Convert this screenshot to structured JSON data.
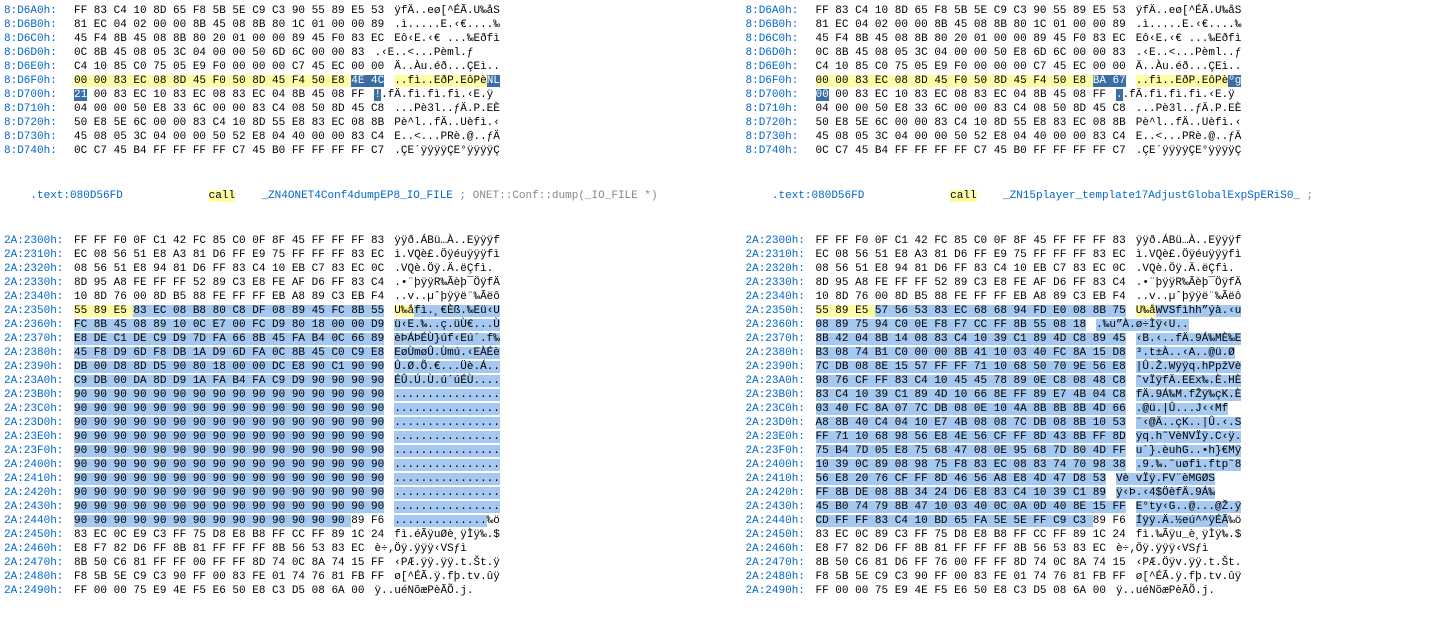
{
  "left": {
    "upper": [
      {
        "addr": "8:D6A0h:",
        "bytes": "FF 83 C4 10 8D 65 F8 5B 5E C9 C3 90 55 89 E5 53",
        "ascii": "ÿfÄ..eø[^ÉÃ.U‰åS"
      },
      {
        "addr": "8:D6B0h:",
        "bytes": "81 EC 04 02 00 00 8B 45 08 8B 80 1C 01 00 00 89",
        "ascii": ".ì.....E.‹€....‰"
      },
      {
        "addr": "8:D6C0h:",
        "bytes": "45 F4 8B 45 08 8B 80 20 01 00 00 89 45 F0 83 EC",
        "ascii": "Eô‹E.‹€ ...‰Eðfì"
      },
      {
        "addr": "8:D6D0h:",
        "bytes": "0C 8B 45 08 05 3C 04 00 00 50 6D 6C 00 00 83",
        "ascii": ".‹E..<...Pèml.ƒ"
      },
      {
        "addr": "8:D6E0h:",
        "bytes": "C4 10 85 C0 75 05 E9 F0 00 00 00 C7 45 EC 00 00",
        "ascii": "Ä..Àu.éð...ÇEì.."
      },
      {
        "addr": "8:D6F0h:",
        "bytes": "",
        "ascii": "..fì..EðP.EôPè",
        "hlbytes": [
          {
            "t": "00 00 83 EC 08 8D 45 F0 50 8D 45 F4 50 E8 ",
            "cls": "hl-yellow"
          },
          {
            "t": "4E 4C",
            "cls": "hl-blue-dark"
          }
        ],
        "asciiparts": [
          {
            "t": "..fì..EðP.EôPè",
            "cls": "hl-yellow"
          },
          {
            "t": "NL",
            "cls": "hl-blue-dark"
          }
        ]
      },
      {
        "addr": "8:D700h:",
        "bytes": "",
        "ascii": "",
        "hlbytes": [
          {
            "t": "21",
            "cls": "hl-blue-dark"
          },
          {
            "t": " 00 83 EC 10 83 EC 08 83 EC 04 8B 45 08 FF",
            "cls": ""
          }
        ],
        "asciiparts": [
          {
            "t": "!",
            "cls": "hl-blue-dark"
          },
          {
            "t": ".fÄ.fì.fì.fì.‹E.ÿ",
            "cls": ""
          }
        ]
      },
      {
        "addr": "8:D710h:",
        "bytes": "04 00 00 50 E8 33 6C 00 00 83 C4 08 50 8D 45 C8",
        "ascii": "...Pè3l..ƒÄ.P.EÈ"
      },
      {
        "addr": "8:D720h:",
        "bytes": "50 E8 5E 6C 00 00 83 C4 10 8D 55 E8 83 EC 08 8B",
        "ascii": "Pè^l..fÄ..Uèfì.‹"
      },
      {
        "addr": "8:D730h:",
        "bytes": "45 08 05 3C 04 00 00 50 52 E8 04 40 00 00 83 C4",
        "ascii": "E..<...PRè.@..ƒÄ"
      },
      {
        "addr": "8:D740h:",
        "bytes": "0C C7 45 B4 FF FF FF FF C7 45 B0 FF FF FF FF C7",
        "ascii": ".ÇE´ÿÿÿÿÇE°ÿÿÿÿÇ"
      }
    ],
    "disasm": {
      "addr": ".text:080D56FD",
      "mnem": "call",
      "op": "_ZN4ONET4Conf4dumpEP8_IO_FILE",
      "comment": "; ONET::Conf::dump(_IO_FILE *)"
    },
    "lower": [
      {
        "addr": "2A:2300h:",
        "bytes": "FF FF F0 0F C1 42 FC 85 C0 0F 8F 45 FF FF FF 83",
        "ascii": "ÿÿð.ÁBü…À..Eÿÿÿf"
      },
      {
        "addr": "2A:2310h:",
        "bytes": "EC 08 56 51 E8 A3 81 D6 FF E9 75 FF FF FF 83 EC",
        "ascii": "ì.VQè£.Öÿéuÿÿÿfì"
      },
      {
        "addr": "2A:2320h:",
        "bytes": "08 56 51 E8 94 81 D6 FF 83 C4 10 EB C7 83 EC 0C",
        "ascii": ".VQè.Öÿ.Ä.ëÇfì."
      },
      {
        "addr": "2A:2330h:",
        "bytes": "8D 95 A8 FE FF FF 52 89 C3 E8 FE AF D6 FF 83 C4",
        "ascii": ".•¨þÿÿR‰Ãèþ¯ÖÿfÄ"
      },
      {
        "addr": "2A:2340h:",
        "bytes": "10 8D 76 00 8D B5 88 FE FF FF EB A8 89 C3 EB F4",
        "ascii": "..v..µˆþÿÿë¨‰Ãëô"
      },
      {
        "addr": "2A:2350h:",
        "bytes": "",
        "hlbytes": [
          {
            "t": "55 89 E5 ",
            "cls": "hl-yellow"
          },
          {
            "t": "83 EC 08 B8 80 C8 DF 08 89 45 FC 8B 55",
            "cls": "hl-blue"
          }
        ],
        "asciiparts": [
          {
            "t": "U‰å",
            "cls": "hl-yellow"
          },
          {
            "t": "fì.¸€Èß.‰Eü‹U",
            "cls": "hl-blue"
          }
        ]
      },
      {
        "addr": "2A:2360h:",
        "bytes": "",
        "hlbytes": [
          {
            "t": "FC 8B 45 08 89 10 0C E7 00 FC D9 80 18 00 00 D9",
            "cls": "hl-blue"
          }
        ],
        "asciiparts": [
          {
            "t": "ü‹E.‰..ç.üÙ€...Ù",
            "cls": "hl-blue"
          }
        ]
      },
      {
        "addr": "2A:2370h:",
        "bytes": "",
        "hlbytes": [
          {
            "t": "E8 DE C1 DE C9 D9 7D FA 66 8B 45 FA B4 0C 66 89",
            "cls": "hl-blue"
          }
        ],
        "asciiparts": [
          {
            "t": "èÞÁÞÉÙ}úf‹Eú´.f‰",
            "cls": "hl-blue"
          }
        ]
      },
      {
        "addr": "2A:2380h:",
        "bytes": "",
        "hlbytes": [
          {
            "t": "45 F8 D9 6D F8 DB 1A D9 6D FA 0C 8B 45 C0 C9 E8",
            "cls": "hl-blue"
          }
        ],
        "asciiparts": [
          {
            "t": "EøÙmøÛ.Ùmú.‹EÀÉè",
            "cls": "hl-blue"
          }
        ]
      },
      {
        "addr": "2A:2390h:",
        "bytes": "",
        "hlbytes": [
          {
            "t": "DB 00 D8 8D D5 90 80 18 00 00 DC E8 90 C1 90 90",
            "cls": "hl-blue"
          }
        ],
        "asciiparts": [
          {
            "t": "Û.Ø.Õ.€...Üè.Á..",
            "cls": "hl-blue"
          }
        ]
      },
      {
        "addr": "2A:23A0h:",
        "bytes": "",
        "hlbytes": [
          {
            "t": "C9 DB 00 DA 8D D9 1A FA B4 FA C9 D9 90 90 90 90",
            "cls": "hl-blue"
          }
        ],
        "asciiparts": [
          {
            "t": "ÉÛ.Ú.Ù.ú´úÉÙ....",
            "cls": "hl-blue"
          }
        ]
      },
      {
        "addr": "2A:23B0h:",
        "bytes": "",
        "hlbytes": [
          {
            "t": "90 90 90 90 90 90 90 90 90 90 90 90 90 90 90 90",
            "cls": "hl-blue"
          }
        ],
        "asciiparts": [
          {
            "t": "................",
            "cls": "hl-blue"
          }
        ]
      },
      {
        "addr": "2A:23C0h:",
        "bytes": "",
        "hlbytes": [
          {
            "t": "90 90 90 90 90 90 90 90 90 90 90 90 90 90 90 90",
            "cls": "hl-blue"
          }
        ],
        "asciiparts": [
          {
            "t": "................",
            "cls": "hl-blue"
          }
        ]
      },
      {
        "addr": "2A:23D0h:",
        "bytes": "",
        "hlbytes": [
          {
            "t": "90 90 90 90 90 90 90 90 90 90 90 90 90 90 90 90",
            "cls": "hl-blue"
          }
        ],
        "asciiparts": [
          {
            "t": "................",
            "cls": "hl-blue"
          }
        ]
      },
      {
        "addr": "2A:23E0h:",
        "bytes": "",
        "hlbytes": [
          {
            "t": "90 90 90 90 90 90 90 90 90 90 90 90 90 90 90 90",
            "cls": "hl-blue"
          }
        ],
        "asciiparts": [
          {
            "t": "................",
            "cls": "hl-blue"
          }
        ]
      },
      {
        "addr": "2A:23F0h:",
        "bytes": "",
        "hlbytes": [
          {
            "t": "90 90 90 90 90 90 90 90 90 90 90 90 90 90 90 90",
            "cls": "hl-blue"
          }
        ],
        "asciiparts": [
          {
            "t": "................",
            "cls": "hl-blue"
          }
        ]
      },
      {
        "addr": "2A:2400h:",
        "bytes": "",
        "hlbytes": [
          {
            "t": "90 90 90 90 90 90 90 90 90 90 90 90 90 90 90 90",
            "cls": "hl-blue"
          }
        ],
        "asciiparts": [
          {
            "t": "................",
            "cls": "hl-blue"
          }
        ]
      },
      {
        "addr": "2A:2410h:",
        "bytes": "",
        "hlbytes": [
          {
            "t": "90 90 90 90 90 90 90 90 90 90 90 90 90 90 90 90",
            "cls": "hl-blue"
          }
        ],
        "asciiparts": [
          {
            "t": "................",
            "cls": "hl-blue"
          }
        ]
      },
      {
        "addr": "2A:2420h:",
        "bytes": "",
        "hlbytes": [
          {
            "t": "90 90 90 90 90 90 90 90 90 90 90 90 90 90 90 90",
            "cls": "hl-blue"
          }
        ],
        "asciiparts": [
          {
            "t": "................",
            "cls": "hl-blue"
          }
        ]
      },
      {
        "addr": "2A:2430h:",
        "bytes": "",
        "hlbytes": [
          {
            "t": "90 90 90 90 90 90 90 90 90 90 90 90 90 90 90 90",
            "cls": "hl-blue"
          }
        ],
        "asciiparts": [
          {
            "t": "................",
            "cls": "hl-blue"
          }
        ]
      },
      {
        "addr": "2A:2440h:",
        "bytes": "",
        "hlbytes": [
          {
            "t": "90 90 90 90 90 90 90 90 90 90 90 90 90 90 ",
            "cls": "hl-blue"
          },
          {
            "t": "89 F6",
            "cls": ""
          }
        ],
        "asciiparts": [
          {
            "t": "..............",
            "cls": "hl-blue"
          },
          {
            "t": "‰ö",
            "cls": ""
          }
        ]
      },
      {
        "addr": "2A:2450h:",
        "bytes": "83 EC 0C E9 C3 FF 75 D8 E8 B8 FF CC FF 89 1C 24",
        "ascii": "fì.éÃÿuØè¸ÿÌÿ‰.$"
      },
      {
        "addr": "2A:2460h:",
        "bytes": "E8 F7 82 D6 FF 8B 81 FF FF FF 8B 56 53 83 EC",
        "ascii": "è÷‚Öÿ.ÿÿÿ‹VSƒì"
      },
      {
        "addr": "2A:2470h:",
        "bytes": "8B 50 C6 81 FF FF 00 FF FF 8D 74 0C 8A 74 15 FF",
        "ascii": "‹PÆ.ÿÿ.ÿÿ.t.Št.ÿ"
      },
      {
        "addr": "2A:2480h:",
        "bytes": "F8 5B 5E C9 C3 90 FF 00 83 FE 01 74 76 81 FB FF",
        "ascii": "ø[^ÉÃ.ÿ.fþ.tv.ûÿ"
      },
      {
        "addr": "2A:2490h:",
        "bytes": "FF 00 00 75 E9 4E F5 E6 50 E8 C3 D5 08 6A 00",
        "ascii": "ÿ..uéNõæPèÃÕ.j."
      }
    ]
  },
  "right": {
    "upper": [
      {
        "addr": "8:D6A0h:",
        "bytes": "FF 83 C4 10 8D 65 F8 5B 5E C9 C3 90 55 89 E5 53",
        "ascii": "ÿfÄ..eø[^ÉÃ.U‰åS"
      },
      {
        "addr": "8:D6B0h:",
        "bytes": "81 EC 04 02 00 00 8B 45 08 8B 80 1C 01 00 00 89",
        "ascii": ".ì.....E.‹€....‰"
      },
      {
        "addr": "8:D6C0h:",
        "bytes": "45 F4 8B 45 08 8B 80 20 01 00 00 89 45 F0 83 EC",
        "ascii": "Eô‹E.‹€ ...‰Eðfì"
      },
      {
        "addr": "8:D6D0h:",
        "bytes": "0C 8B 45 08 05 3C 04 00 00 50 E8 6D 6C 00 00 83",
        "ascii": ".‹E..<...Pèml..ƒ"
      },
      {
        "addr": "8:D6E0h:",
        "bytes": "C4 10 85 C0 75 05 E9 F0 00 00 00 C7 45 EC 00 00",
        "ascii": "Ä..Àu.éð...ÇEì.."
      },
      {
        "addr": "8:D6F0h:",
        "bytes": "",
        "hlbytes": [
          {
            "t": "00 00 83 EC 08 8D 45 F0 50 8D 45 F4 50 E8 ",
            "cls": "hl-yellow"
          },
          {
            "t": "BA 67",
            "cls": "hl-blue-dark"
          }
        ],
        "asciiparts": [
          {
            "t": "..fì..EðP.EôPè",
            "cls": "hl-yellow"
          },
          {
            "t": "ºg",
            "cls": "hl-blue-dark"
          }
        ]
      },
      {
        "addr": "8:D700h:",
        "bytes": "",
        "hlbytes": [
          {
            "t": "00",
            "cls": "hl-blue-dark"
          },
          {
            "t": " 00 83 EC 10 83 EC 08 83 EC 04 8B 45 08 FF",
            "cls": ""
          }
        ],
        "asciiparts": [
          {
            "t": ".",
            "cls": "hl-blue-dark"
          },
          {
            "t": ".fÄ.fì.fì.fì.‹E.ÿ",
            "cls": ""
          }
        ]
      },
      {
        "addr": "8:D710h:",
        "bytes": "04 00 00 50 E8 33 6C 00 00 83 C4 08 50 8D 45 C8",
        "ascii": "...Pè3l..ƒÄ.P.EÈ"
      },
      {
        "addr": "8:D720h:",
        "bytes": "50 E8 5E 6C 00 00 83 C4 10 8D 55 E8 83 EC 08 8B",
        "ascii": "Pè^l..fÄ..Uèfì.‹"
      },
      {
        "addr": "8:D730h:",
        "bytes": "45 08 05 3C 04 00 00 50 52 E8 04 40 00 00 83 C4",
        "ascii": "E..<...PRè.@..ƒÄ"
      },
      {
        "addr": "8:D740h:",
        "bytes": "0C C7 45 B4 FF FF FF FF C7 45 B0 FF FF FF FF C7",
        "ascii": ".ÇE´ÿÿÿÿÇE°ÿÿÿÿÇ"
      }
    ],
    "disasm": {
      "addr": ".text:080D56FD",
      "mnem": "call",
      "op": "_ZN15player_template17AdjustGlobalExpSpERiS0_",
      "comment": ";"
    },
    "lower": [
      {
        "addr": "2A:2300h:",
        "bytes": "FF FF F0 0F C1 42 FC 85 C0 0F 8F 45 FF FF FF 83",
        "ascii": "ÿÿð.ÁBü…À..Eÿÿÿf"
      },
      {
        "addr": "2A:2310h:",
        "bytes": "EC 08 56 51 E8 A3 81 D6 FF E9 75 FF FF FF 83 EC",
        "ascii": "ì.VQè£.Öÿéuÿÿÿfì"
      },
      {
        "addr": "2A:2320h:",
        "bytes": "08 56 51 E8 94 81 D6 FF 83 C4 10 EB C7 83 EC 0C",
        "ascii": ".VQè.Öÿ.Ä.ëÇfì."
      },
      {
        "addr": "2A:2330h:",
        "bytes": "8D 95 A8 FE FF FF 52 89 C3 E8 FE AF D6 FF 83 C4",
        "ascii": ".•¨þÿÿR‰Ãèþ¯ÖÿfÄ"
      },
      {
        "addr": "2A:2340h:",
        "bytes": "10 8D 76 00 8D B5 88 FE FF FF EB A8 89 C3 EB F4",
        "ascii": "..v..µˆþÿÿë¨‰Ãëô"
      },
      {
        "addr": "2A:2350h:",
        "bytes": "",
        "hlbytes": [
          {
            "t": "55 89 E5 ",
            "cls": "hl-yellow"
          },
          {
            "t": "57 56 53 83 EC 68 68 94 FD E0 08 8B 75",
            "cls": "hl-blue"
          }
        ],
        "asciiparts": [
          {
            "t": "U‰å",
            "cls": "hl-yellow"
          },
          {
            "t": "WVSfìhh”ýà.‹u",
            "cls": "hl-blue"
          }
        ]
      },
      {
        "addr": "2A:2360h:",
        "bytes": "",
        "hlbytes": [
          {
            "t": "08 89 75 94 C0 0E F8 F7 CC FF 8B 55 08 18",
            "cls": "hl-blue"
          }
        ],
        "asciiparts": [
          {
            "t": ".‰u”À.ø÷Ìÿ‹U..",
            "cls": "hl-blue"
          }
        ]
      },
      {
        "addr": "2A:2370h:",
        "bytes": "",
        "hlbytes": [
          {
            "t": "8B 42 04 8B 14 08 83 C4 10 39 C1 89 4D C8 89 45",
            "cls": "hl-blue"
          }
        ],
        "asciiparts": [
          {
            "t": "‹B.‹..fÄ.9Á‰MÈ‰E",
            "cls": "hl-blue"
          }
        ]
      },
      {
        "addr": "2A:2380h:",
        "bytes": "",
        "hlbytes": [
          {
            "t": "B3 08 74 B1 C0 00 00 8B 41 10 03 40 FC 8A 15 D8",
            "cls": "hl-blue"
          }
        ],
        "asciiparts": [
          {
            "t": "³.t±À..‹A..@ü.Ø",
            "cls": "hl-blue"
          }
        ]
      },
      {
        "addr": "2A:2390h:",
        "bytes": "",
        "hlbytes": [
          {
            "t": "7C DB 08 8E 15 57 FF FF 71 10 68 50 70 9E 56 E8",
            "cls": "hl-blue"
          }
        ],
        "asciiparts": [
          {
            "t": "|Û.Ž.Wÿÿq.hPpžVè",
            "cls": "hl-blue"
          }
        ]
      },
      {
        "addr": "2A:23A0h:",
        "bytes": "",
        "hlbytes": [
          {
            "t": "98 76 CF FF 83 C4 10 45 45 78 89 0E C8 08 48 C8",
            "cls": "hl-blue"
          }
        ],
        "asciiparts": [
          {
            "t": "˜vÏÿfÄ.EEx‰.È.HÈ",
            "cls": "hl-blue"
          }
        ]
      },
      {
        "addr": "2A:23B0h:",
        "bytes": "",
        "hlbytes": [
          {
            "t": "83 C4 10 39 C1 89 4D 10 66 8E FF 89 E7 4B 04 C8",
            "cls": "hl-blue"
          }
        ],
        "asciiparts": [
          {
            "t": "fÄ.9Á‰M.fŽÿ‰çK.È",
            "cls": "hl-blue"
          }
        ]
      },
      {
        "addr": "2A:23C0h:",
        "bytes": "",
        "hlbytes": [
          {
            "t": "03 40 FC 8A 07 7C DB 08 0E 10 4A 8B 8B 8B 4D 66",
            "cls": "hl-blue"
          }
        ],
        "asciiparts": [
          {
            "t": ".@ü.|Û...J‹‹Mf",
            "cls": "hl-blue"
          }
        ]
      },
      {
        "addr": "2A:23D0h:",
        "bytes": "",
        "hlbytes": [
          {
            "t": "A8 8B 40 C4 04 10 E7 4B 08 08 7C DB 08 8B 10 53",
            "cls": "hl-blue"
          }
        ],
        "asciiparts": [
          {
            "t": "¨‹@Ä..çK..|Û.‹.S",
            "cls": "hl-blue"
          }
        ]
      },
      {
        "addr": "2A:23E0h:",
        "bytes": "",
        "hlbytes": [
          {
            "t": "FF 71 10 68 98 56 E8 4E 56 CF FF 8D 43 8B FF 8D",
            "cls": "hl-blue"
          }
        ],
        "asciiparts": [
          {
            "t": "ÿq.h˜VèNVÏÿ.C‹ÿ.",
            "cls": "hl-blue"
          }
        ]
      },
      {
        "addr": "2A:23F0h:",
        "bytes": "",
        "hlbytes": [
          {
            "t": "75 B4 7D 05 E8 75 68 47 08 0E 95 68 7D 80 4D FF",
            "cls": "hl-blue"
          }
        ],
        "asciiparts": [
          {
            "t": "u´}.èuhG..•h}€Mÿ",
            "cls": "hl-blue"
          }
        ]
      },
      {
        "addr": "2A:2400h:",
        "bytes": "",
        "hlbytes": [
          {
            "t": "10 39 0C 89 08 98 75 F8 83 EC 08 83 74 70 98 38",
            "cls": "hl-blue"
          }
        ],
        "asciiparts": [
          {
            "t": ".9.‰.˜uøfì.ftp˜8",
            "cls": "hl-blue"
          }
        ]
      },
      {
        "addr": "2A:2410h:",
        "bytes": "",
        "hlbytes": [
          {
            "t": "56 E8 20 76 CF FF 8D 46 56 A8 E8 4D 47 D8 53",
            "cls": "hl-blue"
          }
        ],
        "asciiparts": [
          {
            "t": "Vè vÏÿ.FV¨èMGØS",
            "cls": "hl-blue"
          }
        ]
      },
      {
        "addr": "2A:2420h:",
        "bytes": "",
        "hlbytes": [
          {
            "t": "FF 8B DE 08 8B 34 24 D6 E8 83 C4 10 39 C1 89",
            "cls": "hl-blue"
          }
        ],
        "asciiparts": [
          {
            "t": "ÿ‹Þ.‹4$ÖèfÄ.9Á‰",
            "cls": "hl-blue"
          }
        ]
      },
      {
        "addr": "2A:2430h:",
        "bytes": "",
        "hlbytes": [
          {
            "t": "45 B0 74 79 8B 47 10 03 40 0C 0A 0D 40 8E 15 FF",
            "cls": "hl-blue"
          }
        ],
        "asciiparts": [
          {
            "t": "E°ty‹G..@...@Ž.ÿ",
            "cls": "hl-blue"
          }
        ]
      },
      {
        "addr": "2A:2440h:",
        "bytes": "",
        "hlbytes": [
          {
            "t": "CD FF FF 83 C4 10 BD 65 FA 5E 5E FF C9 C3 ",
            "cls": "hl-blue"
          },
          {
            "t": "89 F6",
            "cls": ""
          }
        ],
        "asciiparts": [
          {
            "t": "Íÿÿ.Ä.½eú^^ÿÉÃ",
            "cls": "hl-blue"
          },
          {
            "t": "‰ö",
            "cls": ""
          }
        ]
      },
      {
        "addr": "2A:2450h:",
        "bytes": "83 EC 0C 89 C3 FF 75 D8 E8 B8 FF CC FF 89 1C 24",
        "ascii": "fì.‰Ãÿu_è¸ÿÌÿ‰.$"
      },
      {
        "addr": "2A:2460h:",
        "bytes": "E8 F7 82 D6 FF 8B 81 FF FF FF 8B 56 53 83 EC",
        "ascii": "è÷‚Öÿ.ÿÿÿ‹VSƒì"
      },
      {
        "addr": "2A:2470h:",
        "bytes": "8B 50 C6 81 D6 FF 76 00 FF FF 8D 74 0C 8A 74 15",
        "ascii": "‹PÆ.Öÿv.ÿÿ.t.Št."
      },
      {
        "addr": "2A:2480h:",
        "bytes": "F8 5B 5E C9 C3 90 FF 00 83 FE 01 74 76 81 FB FF",
        "ascii": "ø[^ÉÃ.ÿ.fþ.tv.ûÿ"
      },
      {
        "addr": "2A:2490h:",
        "bytes": "FF 00 00 75 E9 4E F5 E6 50 E8 C3 D5 08 6A 00",
        "ascii": "ÿ..uéNõæPèÃÕ.j."
      }
    ]
  }
}
